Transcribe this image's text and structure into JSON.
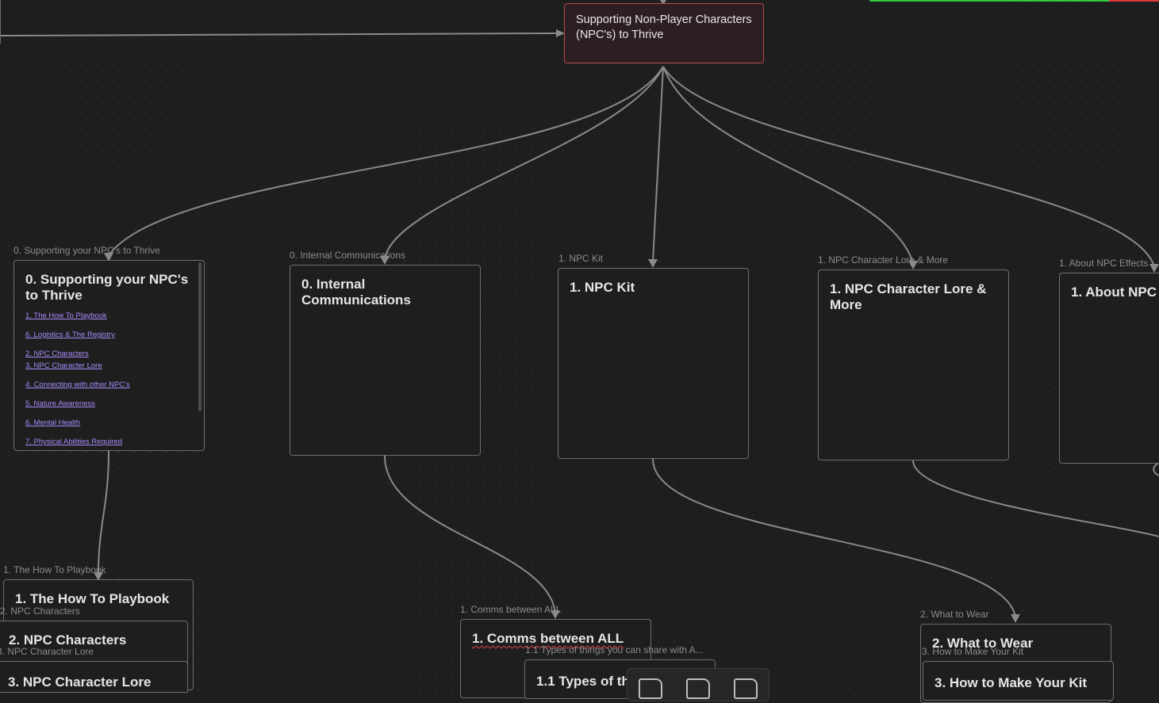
{
  "canvas": {
    "root_node": {
      "text": "Supporting Non-Player Characters (NPC's) to Thrive"
    },
    "groups": [
      {
        "label": "0. Supporting your NPC's to Thrive"
      },
      {
        "label": "0. Internal Communications"
      },
      {
        "label": "1. NPC Kit"
      },
      {
        "label": "1. NPC Character Lore & More"
      },
      {
        "label": "1. About NPC Effects"
      },
      {
        "label": "1. The How To Playbook"
      },
      {
        "label": "2. NPC Characters"
      },
      {
        "label": "3. NPC Character Lore"
      },
      {
        "label": "1. Comms between ALL"
      },
      {
        "label": "1.1 Types of things you can share with A..."
      },
      {
        "label": "2. What to Wear"
      },
      {
        "label": "3. How to Make Your Kit"
      }
    ],
    "cards": {
      "supporting": {
        "title": "0. Supporting your NPC's to Thrive",
        "links": [
          "1. The How To Playbook",
          "6. Logistics & The Registry",
          "2. NPC Characters",
          "3. NPC Character Lore",
          "4. Connecting with other NPC's",
          "5. Nature Awareness",
          "6. Mental Health",
          "7. Physical Abilities Required"
        ]
      },
      "internal": {
        "title": "0. Internal Communications"
      },
      "kit": {
        "title": "1. NPC Kit"
      },
      "lore_more": {
        "title": "1. NPC Character Lore & More"
      },
      "about": {
        "title": "1. About NPC"
      },
      "howto": {
        "title": "1. The How To Playbook"
      },
      "npc_chars": {
        "title": "2. NPC Characters"
      },
      "npc_lore": {
        "title": "3. NPC Character Lore"
      },
      "comms": {
        "title": "1. Comms between ALL"
      },
      "types": {
        "title": "1.1 Types of th"
      },
      "wear": {
        "title": "2. What to Wear"
      },
      "make_kit": {
        "title": "3. How to Make Your Kit"
      }
    },
    "colors": {
      "edge": "#8a8a8a",
      "root_border": "#b94a4e",
      "link": "#a78bfa",
      "progress_green": "#2ecc40",
      "progress_red": "#e03838"
    }
  },
  "toolbar": {
    "icons": [
      "new-note-icon",
      "new-file-icon",
      "new-card-icon"
    ]
  }
}
